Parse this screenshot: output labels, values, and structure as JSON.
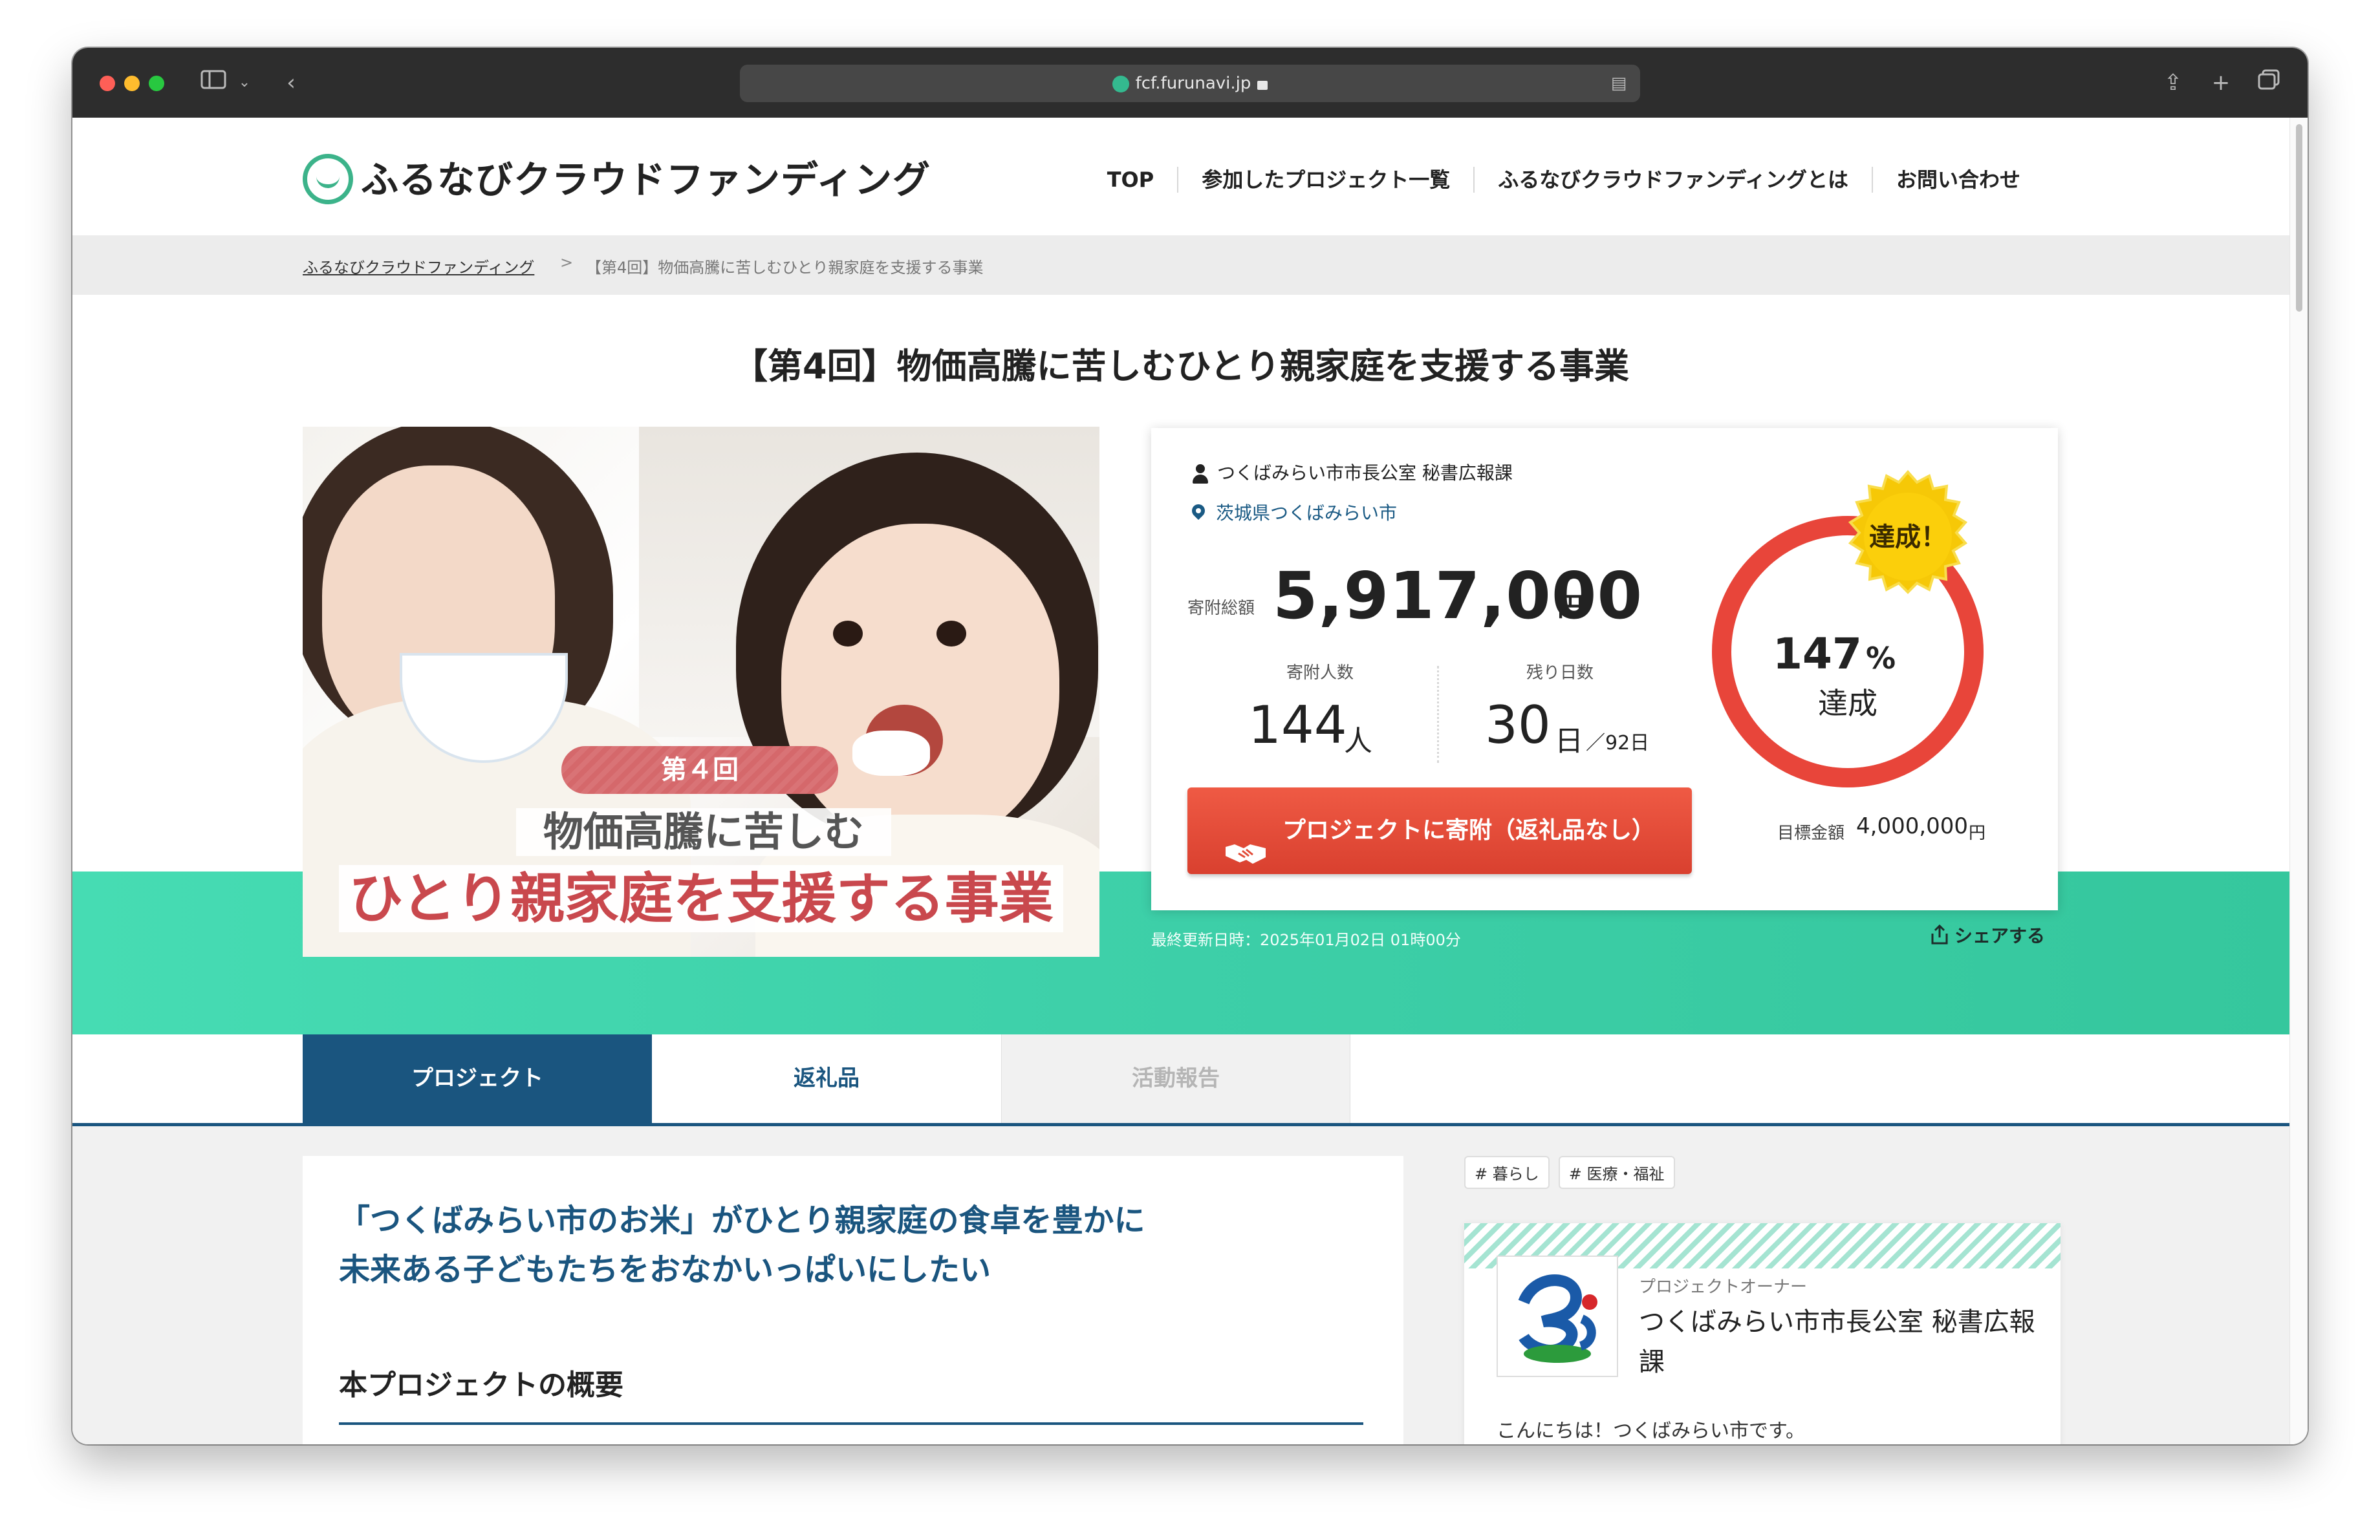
{
  "browser": {
    "url": "fcf.furunavi.jp"
  },
  "site": {
    "logo_text": "ふるなびクラウドファンディング",
    "nav": [
      "TOP",
      "参加したプロジェクト一覧",
      "ふるなびクラウドファンディングとは",
      "お問い合わせ"
    ]
  },
  "breadcrumb": {
    "home": "ふるなびクラウドファンディング",
    "separator": ">",
    "current": "【第4回】物価高騰に苦しむひとり親家庭を支援する事業"
  },
  "project": {
    "title": "【第4回】物価高騰に苦しむひとり親家庭を支援する事業",
    "image": {
      "badge": "第４回",
      "line1": "物価高騰に苦しむ",
      "line2": "ひとり親家庭を支援する事業"
    },
    "owner": "つくばみらい市市長公室 秘書広報課",
    "location": "茨城県つくばみらい市",
    "total_label": "寄附総額",
    "total_amount": "5,917,000",
    "total_unit": "円",
    "donors_label": "寄附人数",
    "donors_count": "144",
    "donors_unit": "人",
    "days_label": "残り日数",
    "days_left": "30",
    "days_unit": "日",
    "days_total": "／92日",
    "donate_button": "プロジェクトに寄附（返礼品なし）",
    "achieved_badge": "達成！",
    "percent": "147",
    "percent_unit": "%",
    "percent_label": "達成",
    "progress_fraction": 1.47,
    "goal_label": "目標金額",
    "goal_amount": "4,000,000",
    "goal_unit": "円",
    "updated": "最終更新日時：2025年01月02日 01時00分",
    "share": "シェアする"
  },
  "tabs": [
    "プロジェクト",
    "返礼品",
    "活動報告"
  ],
  "content": {
    "tagline_1": "「つくばみらい市のお米」がひとり親家庭の食卓を豊かに",
    "tagline_2": "未来ある子どもたちをおなかいっぱいにしたい",
    "overview_heading": "本プロジェクトの概要"
  },
  "sidebar": {
    "tags": [
      "# 暮らし",
      "# 医療・福祉"
    ],
    "owner_label": "プロジェクトオーナー",
    "owner_name": "つくばみらい市市長公室 秘書広報課",
    "greeting": "こんにちは！つくばみらい市です。"
  },
  "colors": {
    "brand_green": "#3cb38a",
    "accent_blue": "#1a557f",
    "donate_red": "#e44a37",
    "ring_red": "#e8453a",
    "badge_gold": "#f5c400",
    "band_teal": "#3dd2a8"
  }
}
